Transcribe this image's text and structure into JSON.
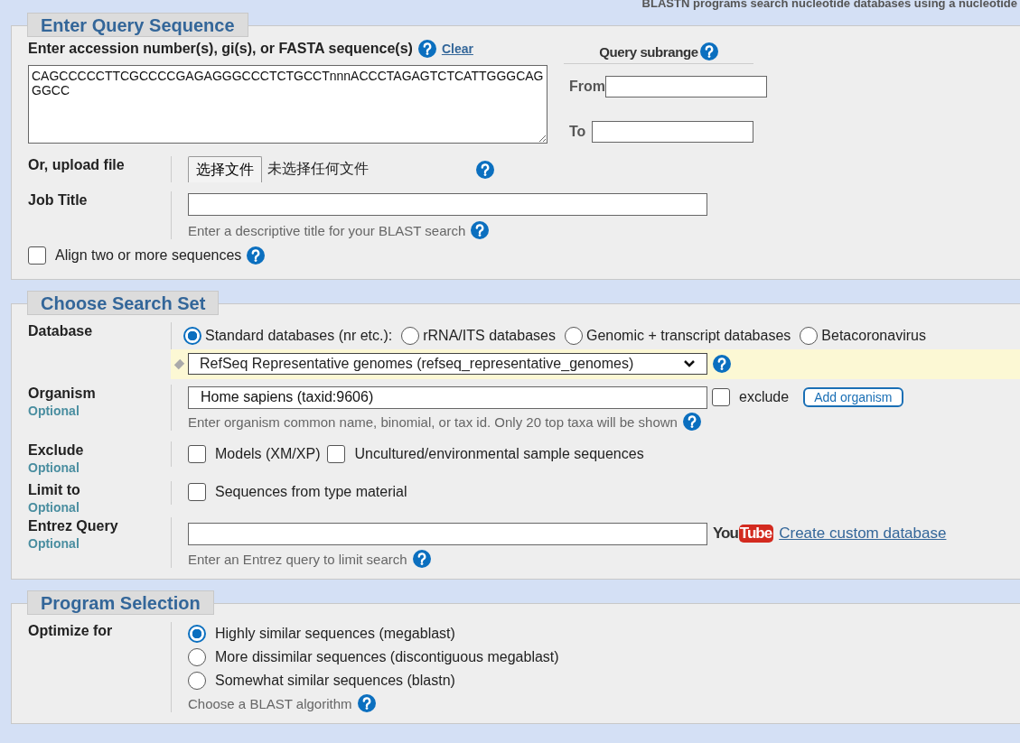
{
  "header_note": "BLASTN programs search nucleotide databases using a nucleotide",
  "query": {
    "title": "Enter Query Sequence",
    "sequence_label": "Enter accession number(s), gi(s), or FASTA sequence(s)",
    "clear_link": "Clear",
    "sequence": "CAGCCCCCTTCGCCCCGAGAGGGCCCTCTGCCTnnnACCCTAGAGTCTCATTGGGCAGGGCC",
    "subrange_title": "Query subrange",
    "from_label": "From",
    "to_label": "To",
    "upload": {
      "label": "Or, upload file",
      "button": "选择文件",
      "status": "未选择任何文件"
    },
    "job_title": {
      "label": "Job Title",
      "hint": "Enter a descriptive title for your BLAST search"
    },
    "align": {
      "label": "Align two or more sequences",
      "checked": false
    }
  },
  "search_set": {
    "title": "Choose Search Set",
    "database": {
      "label": "Database",
      "options": [
        {
          "label": "Standard databases (nr etc.):",
          "selected": true
        },
        {
          "label": "rRNA/ITS databases",
          "selected": false
        },
        {
          "label": "Genomic + transcript databases",
          "selected": false
        },
        {
          "label": "Betacoronavirus",
          "selected": false
        }
      ],
      "select_value": "RefSeq Representative genomes (refseq_representative_genomes)"
    },
    "organism": {
      "label": "Organism",
      "optional": "Optional",
      "value": "Home sapiens (taxid:9606)",
      "exclude_label": "exclude",
      "exclude_checked": false,
      "add_button": "Add organism",
      "hint": "Enter organism common name, binomial, or tax id. Only 20 top taxa will be shown"
    },
    "exclude": {
      "label": "Exclude",
      "optional": "Optional",
      "options": [
        {
          "label": "Models (XM/XP)",
          "checked": false
        },
        {
          "label": "Uncultured/environmental sample sequences",
          "checked": false
        }
      ]
    },
    "limit_to": {
      "label": "Limit to",
      "optional": "Optional",
      "options": [
        {
          "label": "Sequences from type material",
          "checked": false
        }
      ]
    },
    "entrez": {
      "label": "Entrez Query",
      "optional": "Optional",
      "logo_left": "You",
      "logo_right": "Tube",
      "create_link": "Create custom database",
      "hint": "Enter an Entrez query to limit search"
    }
  },
  "program": {
    "title": "Program Selection",
    "optimize": {
      "label": "Optimize for",
      "options": [
        {
          "label": "Highly similar sequences (megablast)",
          "selected": true
        },
        {
          "label": "More dissimilar sequences (discontiguous megablast)",
          "selected": false
        },
        {
          "label": "Somewhat similar sequences (blastn)",
          "selected": false
        }
      ],
      "hint": "Choose a BLAST algorithm"
    }
  }
}
